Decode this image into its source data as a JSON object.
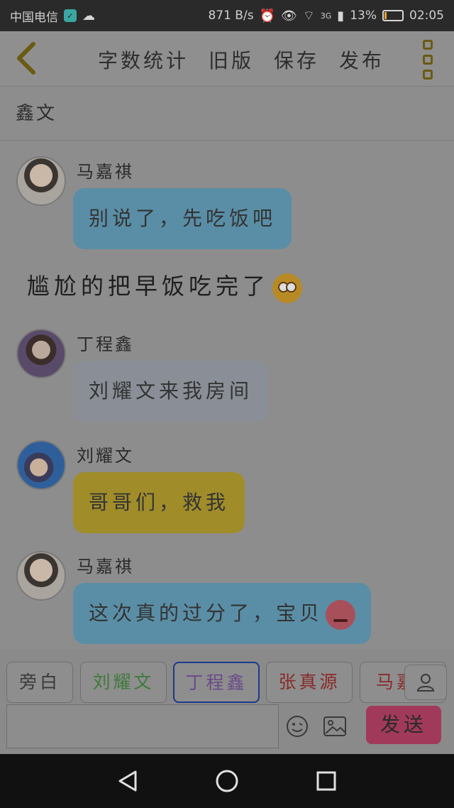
{
  "status_bar": {
    "carrier": "中国电信",
    "speed": "871 B/s",
    "network": "3G",
    "battery": "13%",
    "battery_level": 0.13,
    "time": "02:05"
  },
  "header": {
    "actions": [
      "字数统计",
      "旧版",
      "保存",
      "发布"
    ]
  },
  "subtitle": "鑫文",
  "messages": [
    {
      "type": "character",
      "name": "马嘉祺",
      "text": "别说了，先吃饭吧",
      "color": "#5a8ea6"
    },
    {
      "type": "narration",
      "text": "尴尬的把早饭吃完了"
    },
    {
      "type": "character",
      "name": "丁程鑫",
      "text": "刘耀文来我房间",
      "color": "#8a8f97"
    },
    {
      "type": "character",
      "name": "刘耀文",
      "text": "哥哥们，救我",
      "color": "#a08d2a"
    },
    {
      "type": "character",
      "name": "马嘉祺",
      "text": "这次真的过分了，宝贝",
      "color": "#5a8ea6"
    }
  ],
  "character_chips": [
    {
      "label": "旁白",
      "color": "#3a3a3a"
    },
    {
      "label": "刘耀文",
      "color": "#3f7a3a"
    },
    {
      "label": "丁程鑫",
      "color": "#6a4a8a"
    },
    {
      "label": "张真源",
      "color": "#8a2a2a"
    },
    {
      "label": "马嘉",
      "color": "#8a2a2a"
    }
  ],
  "input": {
    "value": "",
    "send_label": "发送"
  },
  "colors": {
    "accent": "#a13a5a",
    "selected_chip_border": "#1c3a8c"
  }
}
